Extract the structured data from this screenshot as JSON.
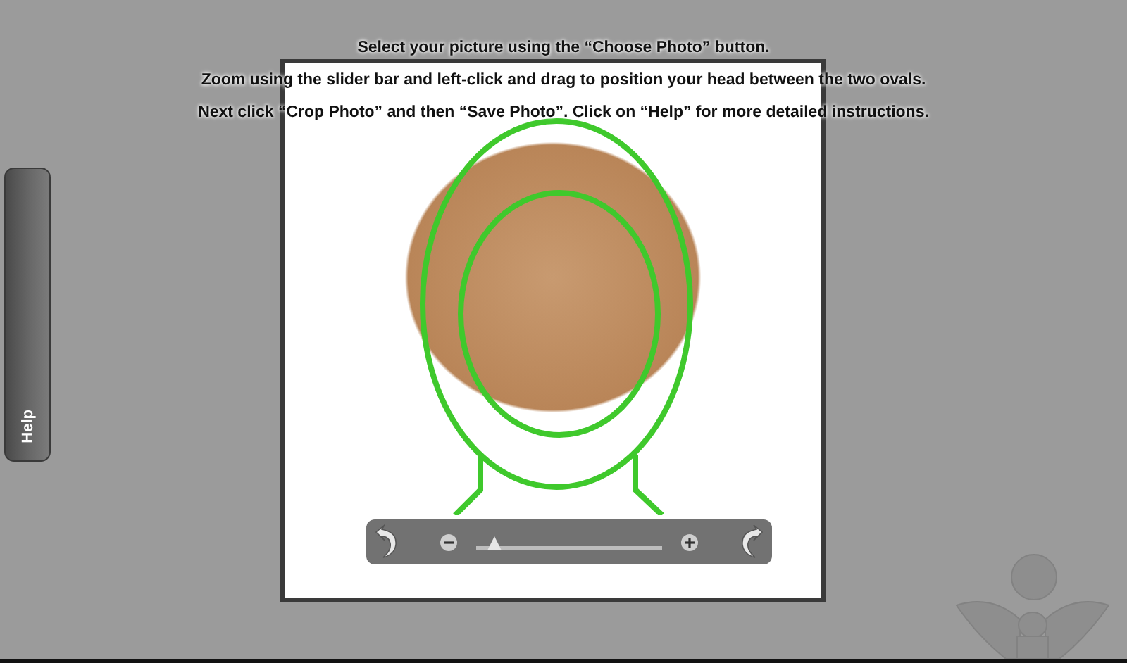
{
  "instructions": [
    "Select your picture using the “Choose Photo” button.",
    "Zoom using the slider bar and left-click and drag to position your head between the two ovals.",
    "Next click “Crop Photo” and then “Save Photo”. Click on “Help” for more detailed instructions."
  ],
  "help_tab": {
    "label": "Help"
  },
  "zoom_slider": {
    "level": 0.1
  }
}
